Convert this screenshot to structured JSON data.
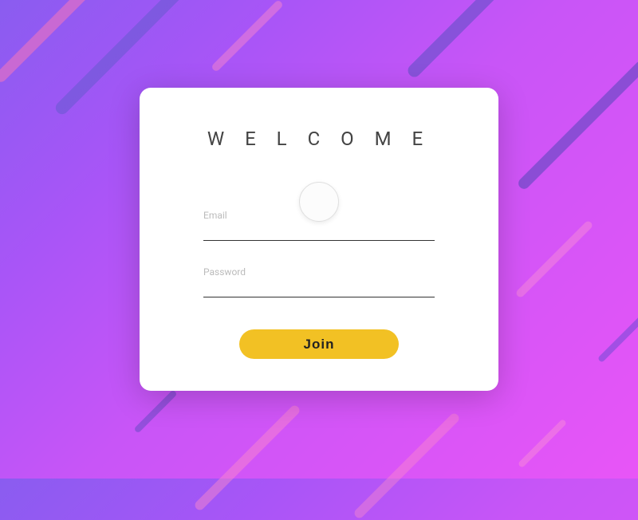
{
  "card": {
    "title": "W E L C O M E",
    "email": {
      "label": "Email",
      "value": ""
    },
    "password": {
      "label": "Password",
      "value": ""
    },
    "join_label": "Join"
  }
}
